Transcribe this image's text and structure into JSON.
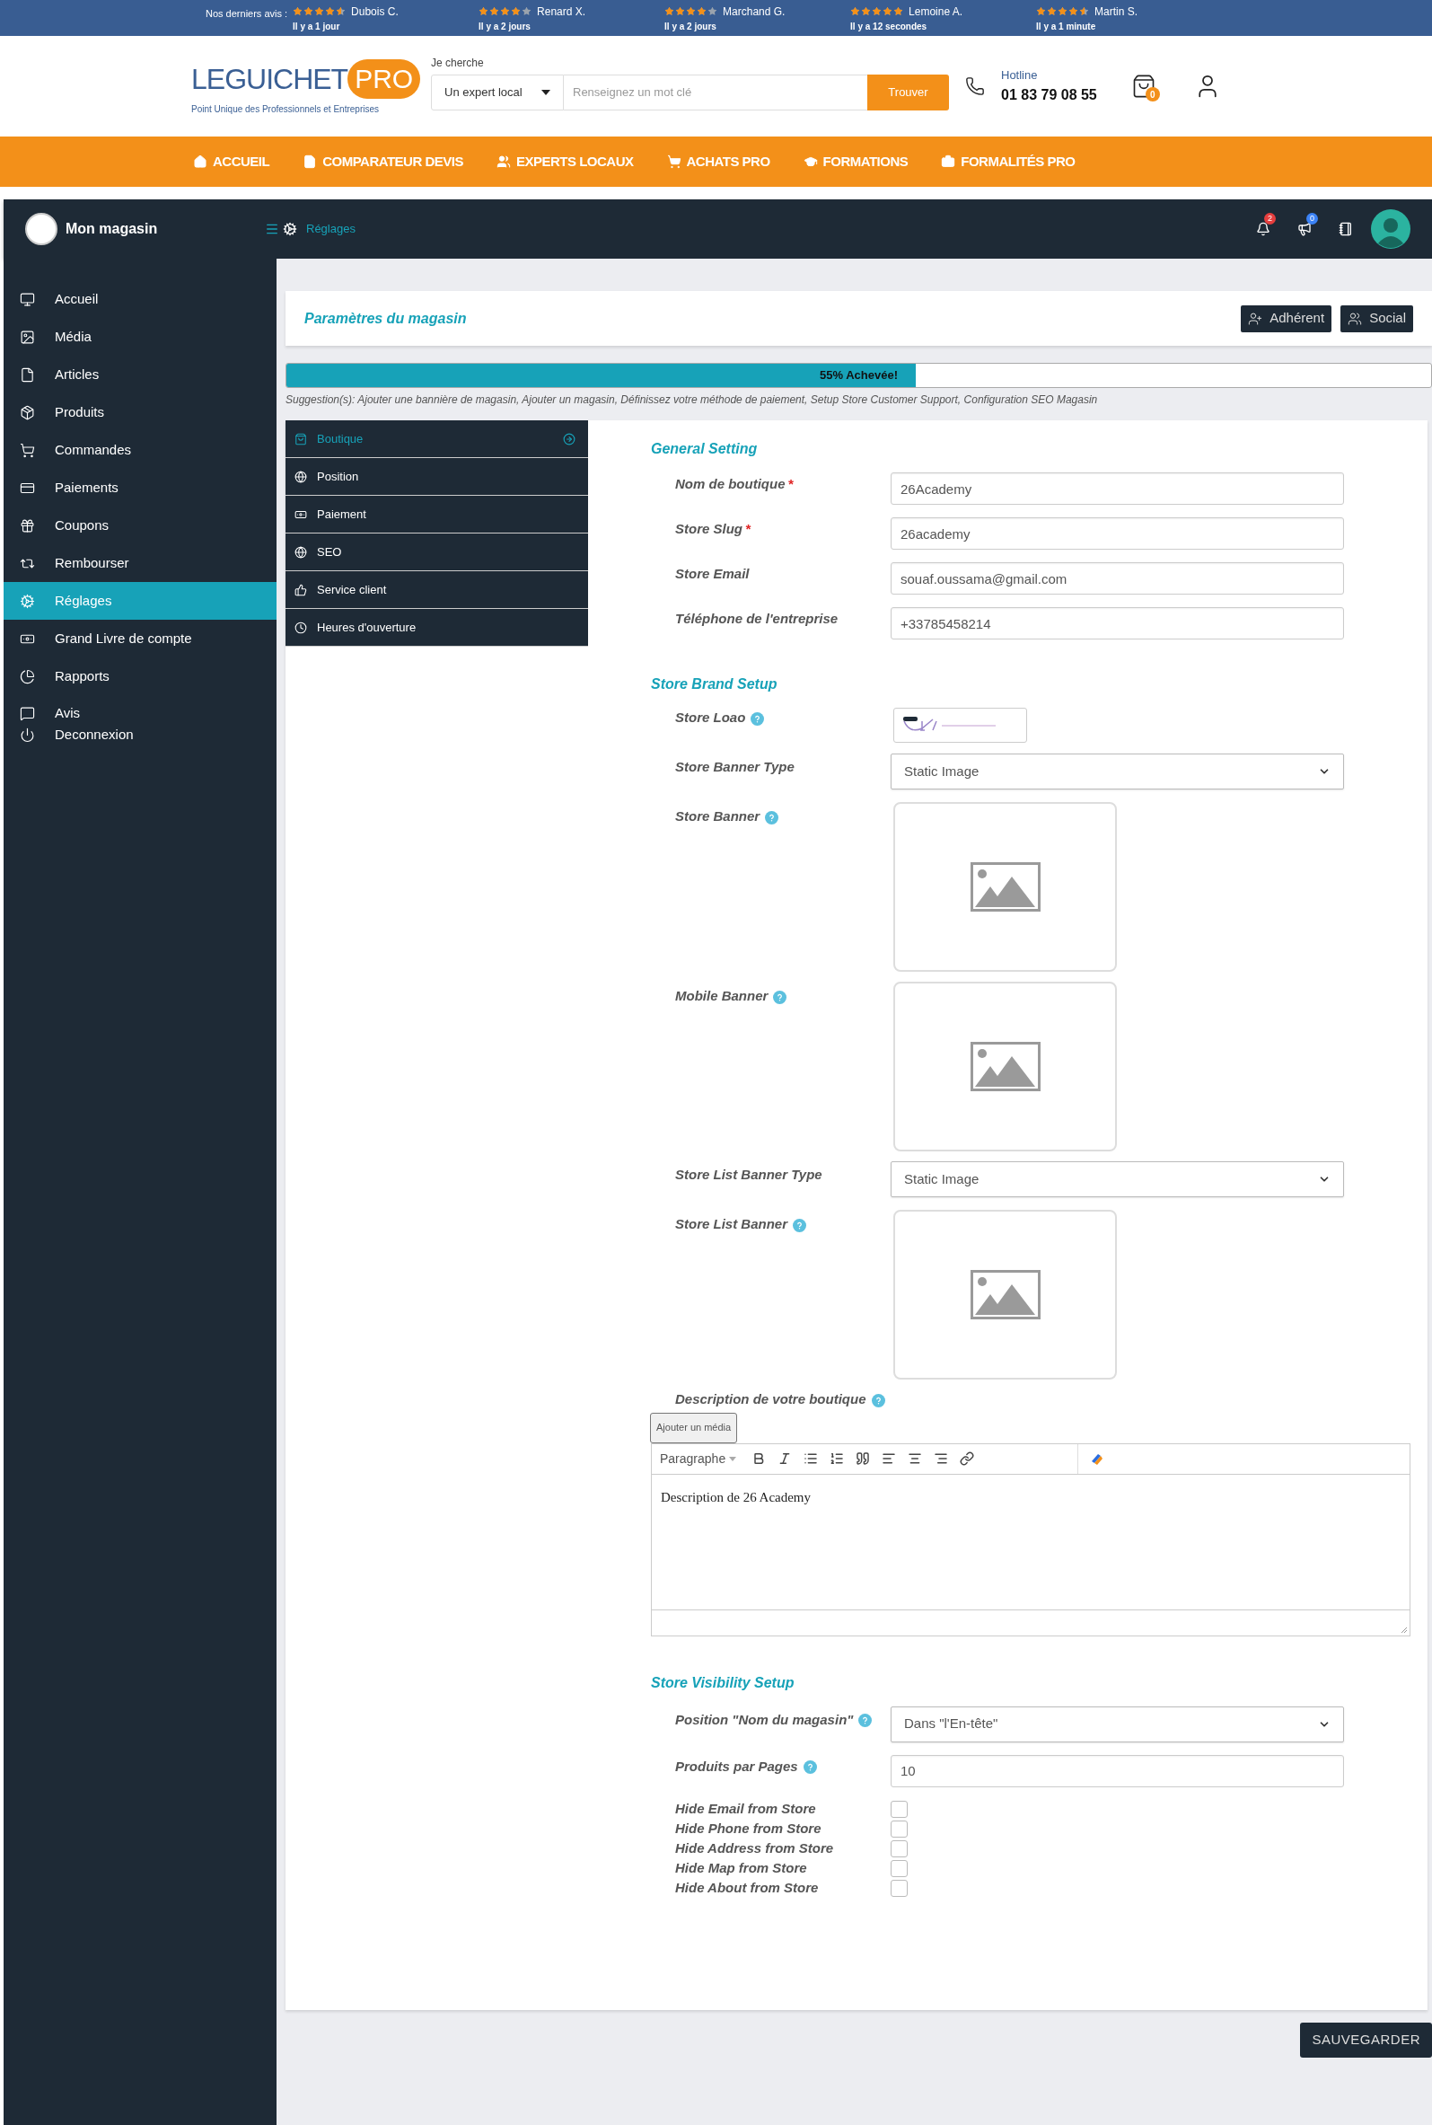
{
  "review_bar": {
    "label": "Nos derniers avis :",
    "reviews": [
      {
        "name": "Dubois C.",
        "time": "Il y a 1 jour",
        "stars": 4.5
      },
      {
        "name": "Renard X.",
        "time": "Il y a 2 jours",
        "stars": 4
      },
      {
        "name": "Marchand G.",
        "time": "Il y a 2 jours",
        "stars": 4
      },
      {
        "name": "Lemoine A.",
        "time": "Il y a 12 secondes",
        "stars": 5
      },
      {
        "name": "Martin S.",
        "time": "Il y a 1 minute",
        "stars": 4.5
      }
    ]
  },
  "header": {
    "logo": {
      "name": "LEGUICHET",
      "accent": "PRO",
      "tagline": "Point Unique des Professionnels et Entreprises"
    },
    "search": {
      "label": "Je cherche",
      "category": "Un expert local",
      "placeholder": "Renseignez un mot clé",
      "button": "Trouver"
    },
    "hotline": {
      "label": "Hotline",
      "number": "01 83 79 08 55"
    },
    "cart_count": "0"
  },
  "main_nav": [
    "ACCUEIL",
    "COMPARATEUR DEVIS",
    "EXPERTS LOCAUX",
    "ACHATS PRO",
    "FORMATIONS",
    "FORMALITÉS PRO"
  ],
  "dashboard": {
    "title": "Mon magasin",
    "breadcrumb": "Réglages",
    "notifications": "2",
    "announcements": "0"
  },
  "sidebar": [
    {
      "label": "Accueil",
      "selected": false
    },
    {
      "label": "Média",
      "selected": false
    },
    {
      "label": "Articles",
      "selected": false
    },
    {
      "label": "Produits",
      "selected": false
    },
    {
      "label": "Commandes",
      "selected": false
    },
    {
      "label": "Paiements",
      "selected": false
    },
    {
      "label": "Coupons",
      "selected": false
    },
    {
      "label": "Rembourser",
      "selected": false
    },
    {
      "label": "Réglages",
      "selected": true
    },
    {
      "label": "Grand Livre de compte",
      "selected": false
    },
    {
      "label": "Rapports",
      "selected": false
    },
    {
      "label": "Avis",
      "selected": false
    },
    {
      "label": "Deconnexion",
      "selected": false
    }
  ],
  "page": {
    "title": "Paramètres du magasin",
    "buttons": [
      "Adhérent",
      "Social"
    ],
    "progress": {
      "level": 0.55,
      "label": "55% Achevée!"
    },
    "suggestions": "Suggestion(s): Ajouter une bannière de magasin, Ajouter un magasin, Définissez votre méthode de paiement, Setup Store Customer Support, Configuration SEO Magasin"
  },
  "settings_tabs": [
    {
      "label": "Boutique",
      "selected": true
    },
    {
      "label": "Position",
      "selected": false
    },
    {
      "label": "Paiement",
      "selected": false
    },
    {
      "label": "SEO",
      "selected": false
    },
    {
      "label": "Service client",
      "selected": false
    },
    {
      "label": "Heures d'ouverture",
      "selected": false
    }
  ],
  "sections": [
    {
      "title": "General Setting",
      "fields": [
        {
          "kind": "text",
          "label": "Nom de boutique",
          "required_mark": "*",
          "help": false,
          "value": "26Academy"
        },
        {
          "kind": "text",
          "label": "Store Slug",
          "required_mark": "*",
          "help": false,
          "value": "26academy"
        },
        {
          "kind": "text",
          "label": "Store Email",
          "help": false,
          "value": "souaf.oussama@gmail.com"
        },
        {
          "kind": "text",
          "label": "Téléphone de l'entreprise",
          "help": false,
          "value": "+33785458214"
        }
      ]
    },
    {
      "title": "Store Brand Setup",
      "fields": [
        {
          "kind": "logo",
          "label": "Store Loao",
          "help": true
        },
        {
          "kind": "select",
          "label": "Store Banner Type",
          "help": false,
          "value": "Static Image"
        },
        {
          "kind": "image",
          "label": "Store Banner",
          "help": true
        },
        {
          "kind": "image",
          "label": "Mobile Banner",
          "help": true
        },
        {
          "kind": "select",
          "label": "Store List Banner Type",
          "help": false,
          "value": "Static Image"
        },
        {
          "kind": "image",
          "label": "Store List Banner",
          "help": true
        },
        {
          "kind": "editor",
          "label": "Description de votre boutique",
          "help": true,
          "media_button": "Ajouter un média",
          "format": "Paragraphe",
          "content": "Description de 26 Academy"
        }
      ]
    },
    {
      "title": "Store Visibility Setup",
      "fields": [
        {
          "kind": "select",
          "label": "Position \"Nom du magasin\"",
          "help": true,
          "value": "Dans \"l'En-tête\""
        },
        {
          "kind": "text",
          "label": "Produits par Pages",
          "help": true,
          "value": "10"
        },
        {
          "kind": "checkbox",
          "label": "Hide Email from Store",
          "help": false,
          "checked": false
        },
        {
          "kind": "checkbox",
          "label": "Hide Phone from Store",
          "help": false,
          "checked": false
        },
        {
          "kind": "checkbox",
          "label": "Hide Address from Store",
          "help": false,
          "checked": false
        },
        {
          "kind": "checkbox",
          "label": "Hide Map from Store",
          "help": false,
          "checked": false
        },
        {
          "kind": "checkbox",
          "label": "Hide About from Store",
          "help": false,
          "checked": false
        }
      ]
    }
  ],
  "save_button": "SAUVEGARDER"
}
